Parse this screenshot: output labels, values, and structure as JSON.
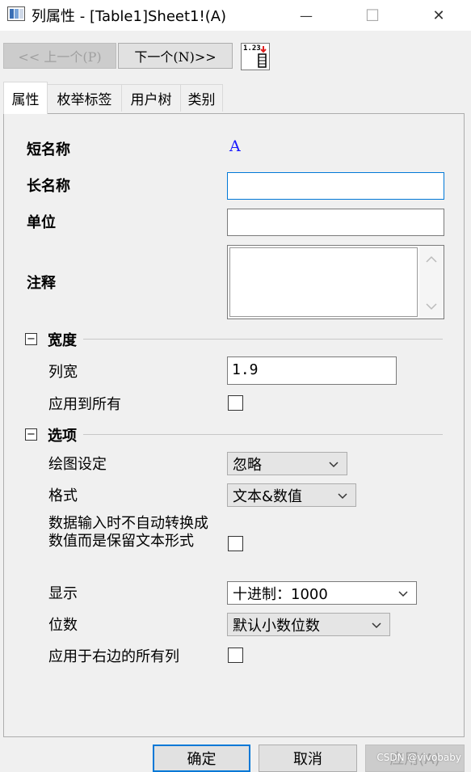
{
  "window": {
    "title": "列属性 - [Table1]Sheet1!(A)",
    "minimize_glyph": "—",
    "maximize_glyph": "☐",
    "close_glyph": "✕"
  },
  "nav": {
    "prev_label": "<< 上一个(P)",
    "next_label": "下一个(N)>>",
    "tool_icon_text": "1.23"
  },
  "tabs": [
    "属性",
    "枚举标签",
    "用户树",
    "类别"
  ],
  "active_tab": 0,
  "form": {
    "short_name_label": "短名称",
    "short_name_value": "A",
    "long_name_label": "长名称",
    "long_name_value": "",
    "units_label": "单位",
    "units_value": "",
    "comments_label": "注释",
    "comments_value": ""
  },
  "width_section": {
    "title": "宽度",
    "collapse_glyph": "−",
    "col_width_label": "列宽",
    "col_width_value": "1.9",
    "apply_all_label": "应用到所有",
    "apply_all_checked": false
  },
  "options_section": {
    "title": "选项",
    "collapse_glyph": "−",
    "plot_label": "绘图设定",
    "plot_value": "忽略",
    "format_label": "格式",
    "format_value": "文本&数值",
    "keep_text_label": "数据输入时不自动转换成数值而是保留文本形式",
    "keep_text_checked": false,
    "display_label": "显示",
    "display_value": "十进制：1000",
    "digits_label": "位数",
    "digits_value": "默认小数位数",
    "apply_right_label": "应用于右边的所有列",
    "apply_right_checked": false
  },
  "buttons": {
    "ok": "确定",
    "cancel": "取消",
    "apply": "应用(A)"
  },
  "watermark": "CSDN @vivobaby",
  "colors": {
    "accent": "#0078d7",
    "value_blue": "#1a1aff"
  }
}
